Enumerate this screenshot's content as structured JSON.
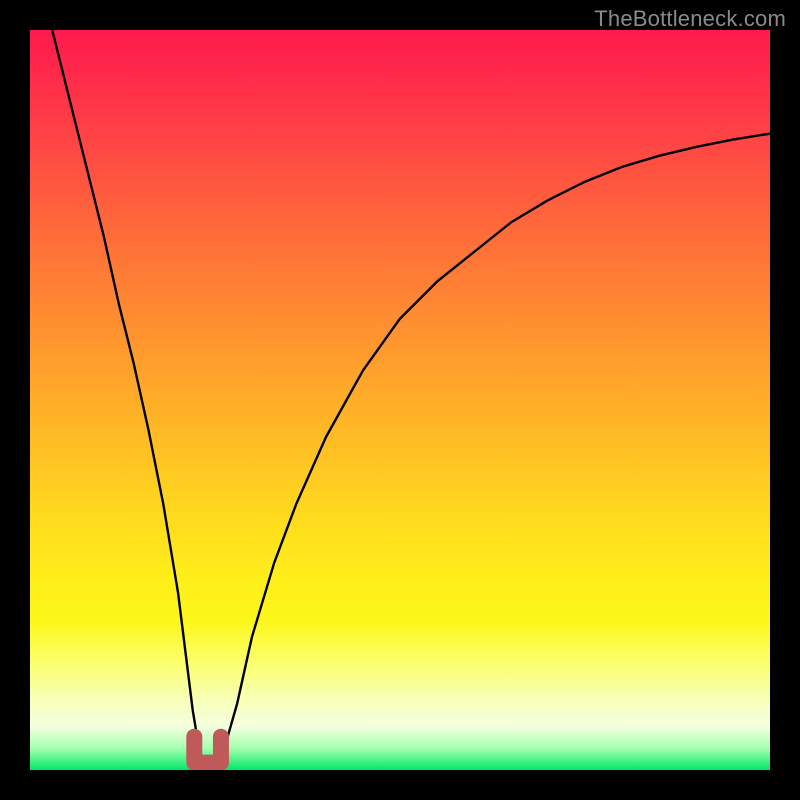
{
  "watermark": "TheBottleneck.com",
  "colors": {
    "background": "#000000",
    "curve": "#000000",
    "marker": "#c05a5a",
    "watermark": "#8a8a8a",
    "gradient_top": "#ff1a4d",
    "gradient_bottom": "#00e968"
  },
  "chart_data": {
    "type": "line",
    "title": "",
    "xlabel": "",
    "ylabel": "",
    "xlim": [
      0,
      100
    ],
    "ylim": [
      0,
      100
    ],
    "grid": false,
    "legend": false,
    "series": [
      {
        "name": "bottleneck-curve",
        "x": [
          3,
          5,
          8,
          10,
          12,
          14,
          16,
          18,
          20,
          21,
          22,
          23,
          24,
          25,
          26,
          28,
          30,
          33,
          36,
          40,
          45,
          50,
          55,
          60,
          65,
          70,
          75,
          80,
          85,
          90,
          95,
          100
        ],
        "values": [
          100,
          92,
          80,
          72,
          63,
          55,
          46,
          36,
          24,
          16,
          8,
          2,
          0,
          0,
          2,
          9,
          18,
          28,
          36,
          45,
          54,
          61,
          66,
          70,
          74,
          77,
          79.5,
          81.5,
          83,
          84.2,
          85.2,
          86
        ]
      }
    ],
    "marker": {
      "name": "minimum-region",
      "x_range": [
        22.2,
        25.8
      ],
      "y": 1.0
    }
  }
}
